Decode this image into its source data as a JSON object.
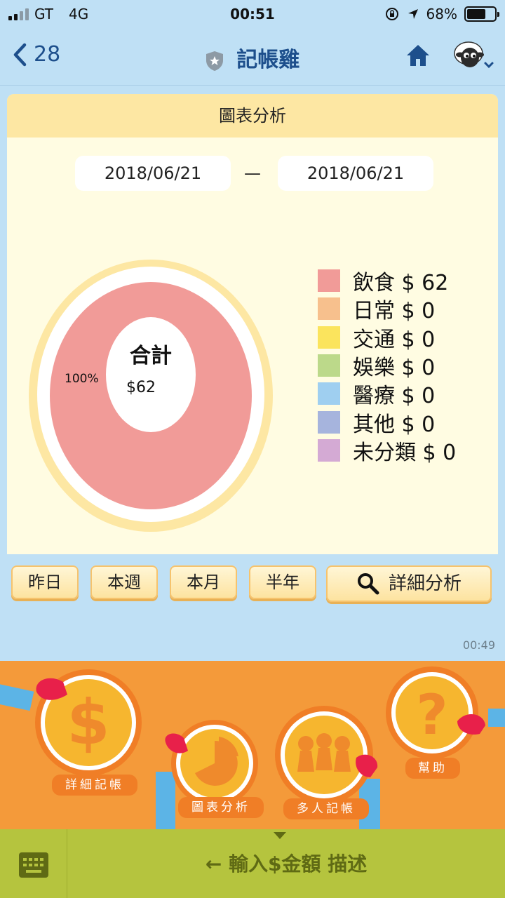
{
  "status_bar": {
    "carrier": "GT",
    "network": "4G",
    "time": "00:51",
    "battery": "68%",
    "battery_level": 0.68
  },
  "nav": {
    "back_count": "28",
    "title": "記帳雞"
  },
  "card": {
    "title": "圖表分析",
    "start_date": "2018/06/21",
    "date_separator": "—",
    "end_date": "2018/06/21",
    "total_label": "合計",
    "total_value": "$62",
    "slice_label": "100%"
  },
  "chart_data": {
    "type": "pie",
    "categories": [
      "飲食",
      "日常",
      "交通",
      "娛樂",
      "醫療",
      "其他",
      "未分類"
    ],
    "values": [
      62,
      0,
      0,
      0,
      0,
      0,
      0
    ],
    "legend": [
      {
        "text": "飲食 $ 62",
        "color": "#f19b98"
      },
      {
        "text": "日常 $ 0",
        "color": "#f7c08d"
      },
      {
        "text": "交通 $ 0",
        "color": "#fbe45d"
      },
      {
        "text": "娛樂 $ 0",
        "color": "#bcd98a"
      },
      {
        "text": "醫療 $ 0",
        "color": "#9fcff0"
      },
      {
        "text": "其他 $ 0",
        "color": "#a6b4dd"
      },
      {
        "text": "未分類 $ 0",
        "color": "#d4aad4"
      }
    ],
    "legend_position": "right"
  },
  "periods": {
    "yesterday": "昨日",
    "this_week": "本週",
    "this_month": "本月",
    "half_year": "半年",
    "detail": "詳細分析"
  },
  "message_time": "00:49",
  "menu": {
    "detail_entry": "詳細記帳",
    "chart_analysis": "圖表分析",
    "group_entry": "多人記帳",
    "help": "幫助"
  },
  "input": {
    "hint": "← 輸入$金額 描述"
  },
  "colors": {
    "accent": "#1d4f8c",
    "menu_bg": "#f49a3a",
    "coin": "#f6b62f",
    "input_bar": "#b5c43e"
  }
}
